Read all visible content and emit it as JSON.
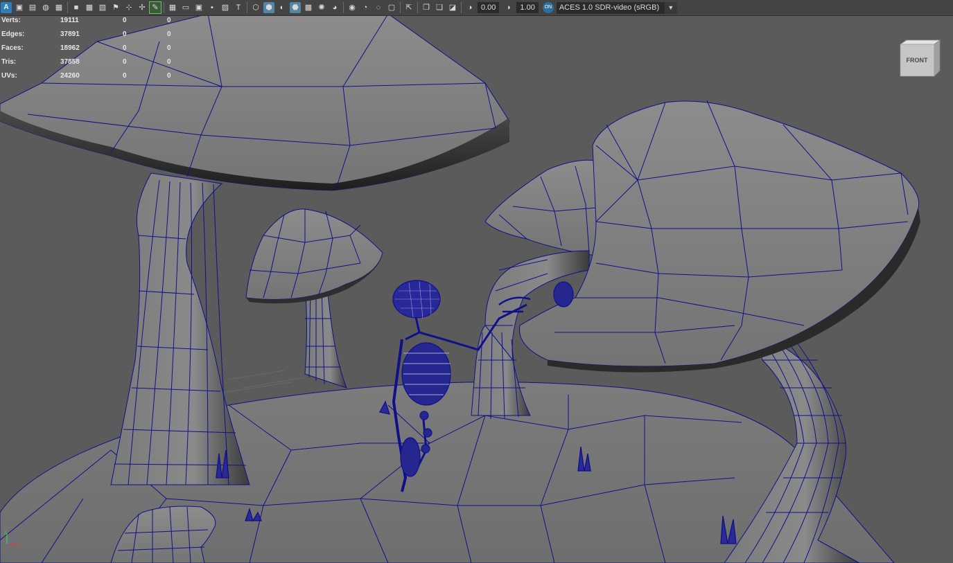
{
  "toolbar": {
    "exposure_value": "0.00",
    "gamma_value": "1.00",
    "color_space_badge": "ON",
    "color_space": "ACES 1.0 SDR-video (sRGB)",
    "dropdown_arrow": "▼"
  },
  "hud": {
    "rows": [
      {
        "label": "Verts:",
        "v1": "19111",
        "v2": "0",
        "v3": "0"
      },
      {
        "label": "Edges:",
        "v1": "37891",
        "v2": "0",
        "v3": "0"
      },
      {
        "label": "Faces:",
        "v1": "18962",
        "v2": "0",
        "v3": "0"
      },
      {
        "label": "Tris:",
        "v1": "37858",
        "v2": "0",
        "v3": "0"
      },
      {
        "label": "UVs:",
        "v1": "24260",
        "v2": "0",
        "v3": "0"
      }
    ]
  },
  "viewcube": {
    "label": "FRONT"
  },
  "axis": {
    "x": "x",
    "y": "y",
    "z": "z"
  },
  "colors": {
    "wire": "#10108a",
    "toolbar": "#444444",
    "viewport_bg": "#5b5b5b",
    "highlight": "#5285a6"
  }
}
